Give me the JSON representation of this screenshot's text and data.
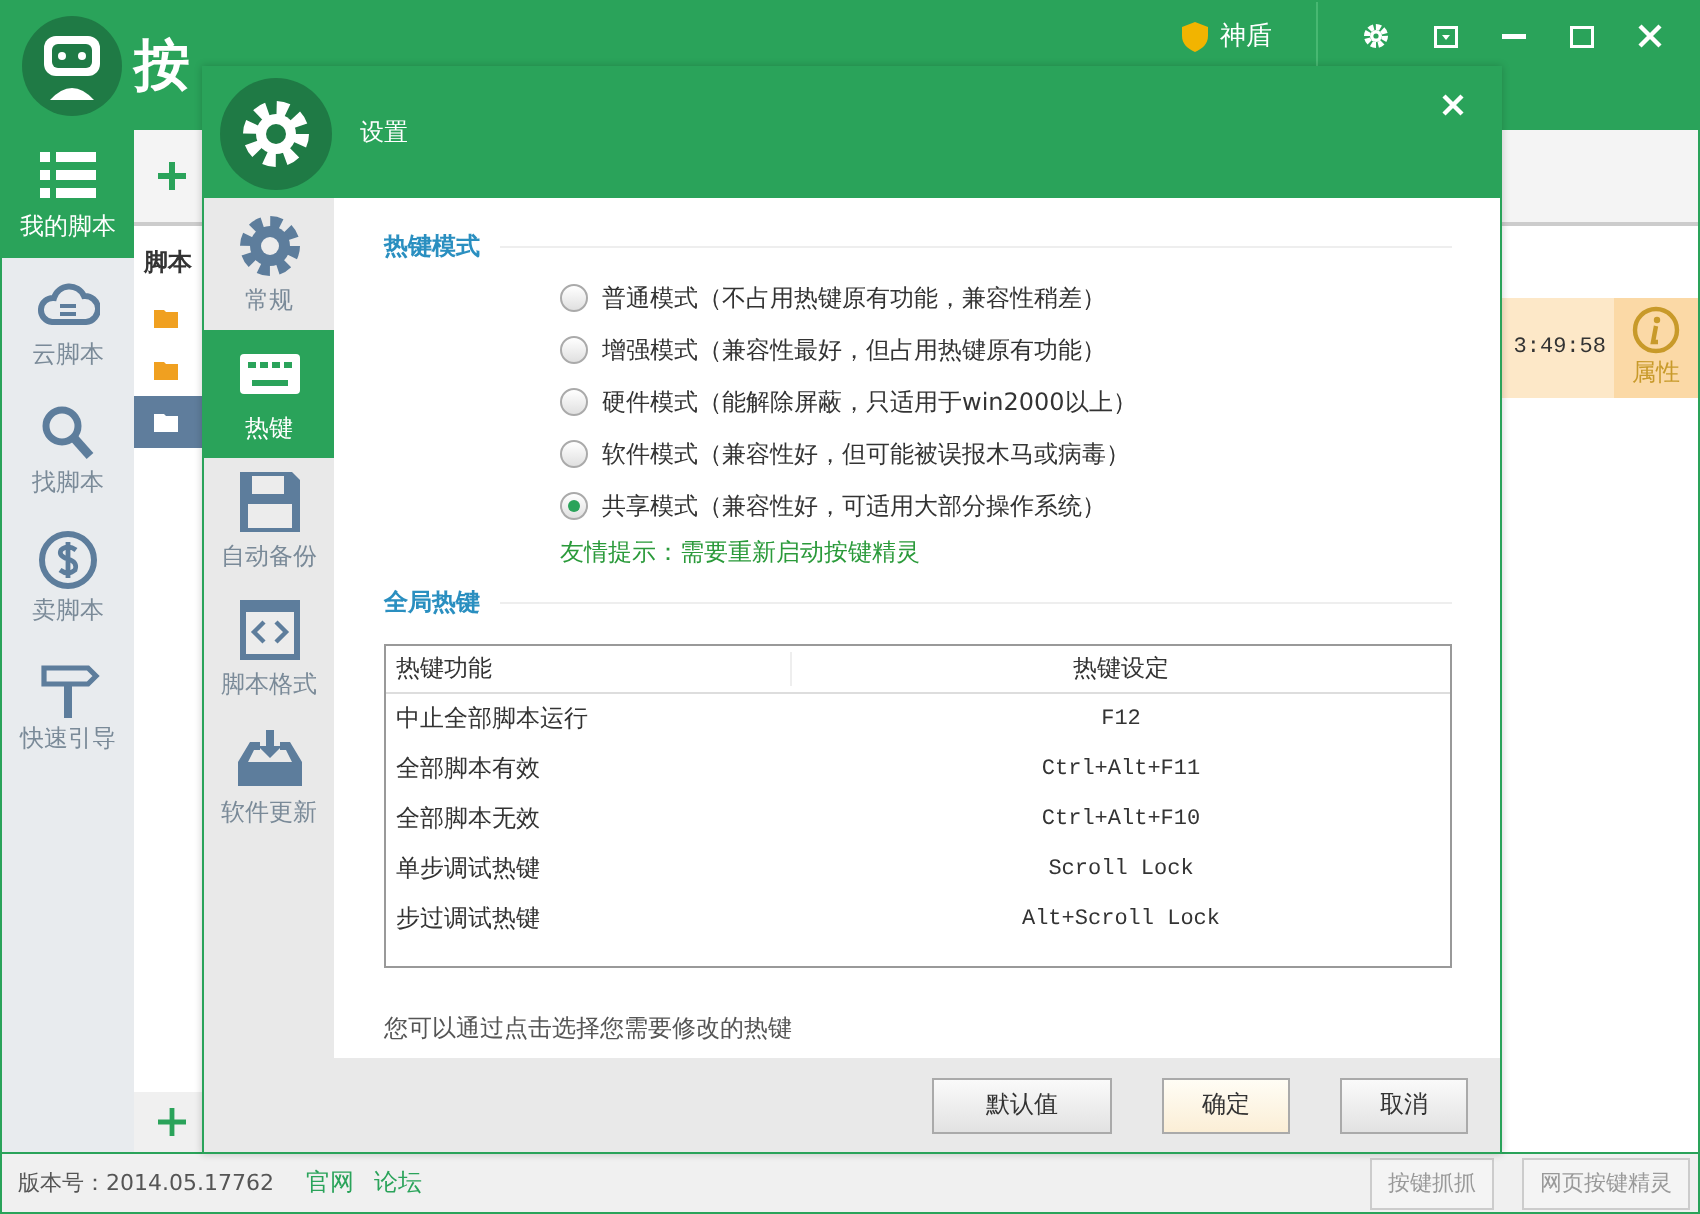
{
  "app": {
    "title": "按",
    "shield_label": "神盾"
  },
  "nav": [
    {
      "label": "我的脚本",
      "kind": "list",
      "selected": true
    },
    {
      "label": "云脚本",
      "kind": "cloud",
      "selected": false
    },
    {
      "label": "找脚本",
      "kind": "search",
      "selected": false
    },
    {
      "label": "卖脚本",
      "kind": "dollar",
      "selected": false
    },
    {
      "label": "快速引导",
      "kind": "sign",
      "selected": false
    }
  ],
  "script_list": {
    "header": "脚本",
    "folders": [
      {
        "selected": false
      },
      {
        "selected": false
      },
      {
        "selected": true
      }
    ]
  },
  "script_row": {
    "time": "3:49:58",
    "action": "属性"
  },
  "dialog": {
    "title": "设置",
    "sidebar": [
      {
        "label": "常规",
        "kind": "gear",
        "selected": false
      },
      {
        "label": "热键",
        "kind": "keyboard",
        "selected": true
      },
      {
        "label": "自动备份",
        "kind": "disk",
        "selected": false
      },
      {
        "label": "脚本格式",
        "kind": "code",
        "selected": false
      },
      {
        "label": "软件更新",
        "kind": "download",
        "selected": false
      }
    ],
    "mode_section": "热键模式",
    "modes": [
      {
        "label": "普通模式（不占用热键原有功能，兼容性稍差）",
        "selected": false
      },
      {
        "label": "增强模式（兼容性最好，但占用热键原有功能）",
        "selected": false
      },
      {
        "label": "硬件模式（能解除屏蔽，只适用于win2000以上）",
        "selected": false
      },
      {
        "label": "软件模式（兼容性好，但可能被误报木马或病毒）",
        "selected": false
      },
      {
        "label": "共享模式（兼容性好，可适用大部分操作系统）",
        "selected": true
      }
    ],
    "tip": "友情提示：需要重新启动按键精灵",
    "global_section": "全局热键",
    "table": {
      "columns": [
        "热键功能",
        "热键设定"
      ],
      "rows": [
        [
          "中止全部脚本运行",
          "F12"
        ],
        [
          "全部脚本有效",
          "Ctrl+Alt+F11"
        ],
        [
          "全部脚本无效",
          "Ctrl+Alt+F10"
        ],
        [
          "单步调试热键",
          "Scroll Lock"
        ],
        [
          "步过调试热键",
          "Alt+Scroll Lock"
        ]
      ]
    },
    "hint": "您可以通过点击选择您需要修改的热键",
    "buttons": [
      {
        "label": "默认值",
        "primary": false
      },
      {
        "label": "确定",
        "primary": true
      },
      {
        "label": "取消",
        "primary": false
      }
    ]
  },
  "footer": {
    "version": "版本号：2014.05.17762",
    "links": [
      "官网",
      "论坛"
    ],
    "buttons": [
      "按键抓抓",
      "网页按键精灵"
    ]
  }
}
